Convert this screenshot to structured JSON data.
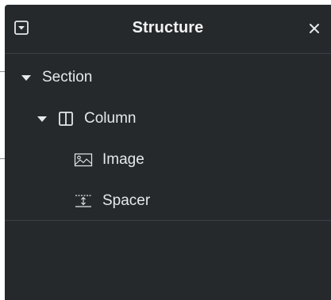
{
  "panel": {
    "title": "Structure",
    "collapse_icon": "collapse-square-icon",
    "close_icon": "close-icon"
  },
  "tree": {
    "section": {
      "label": "Section",
      "icon": "caret-down-icon"
    },
    "column": {
      "label": "Column",
      "icon": "column-layout-icon"
    },
    "image": {
      "label": "Image",
      "icon": "image-icon"
    },
    "spacer": {
      "label": "Spacer",
      "icon": "spacer-icon"
    }
  },
  "colors": {
    "panel_bg": "#26292c",
    "text": "#e6e8ea",
    "divider": "#3b3f44"
  }
}
